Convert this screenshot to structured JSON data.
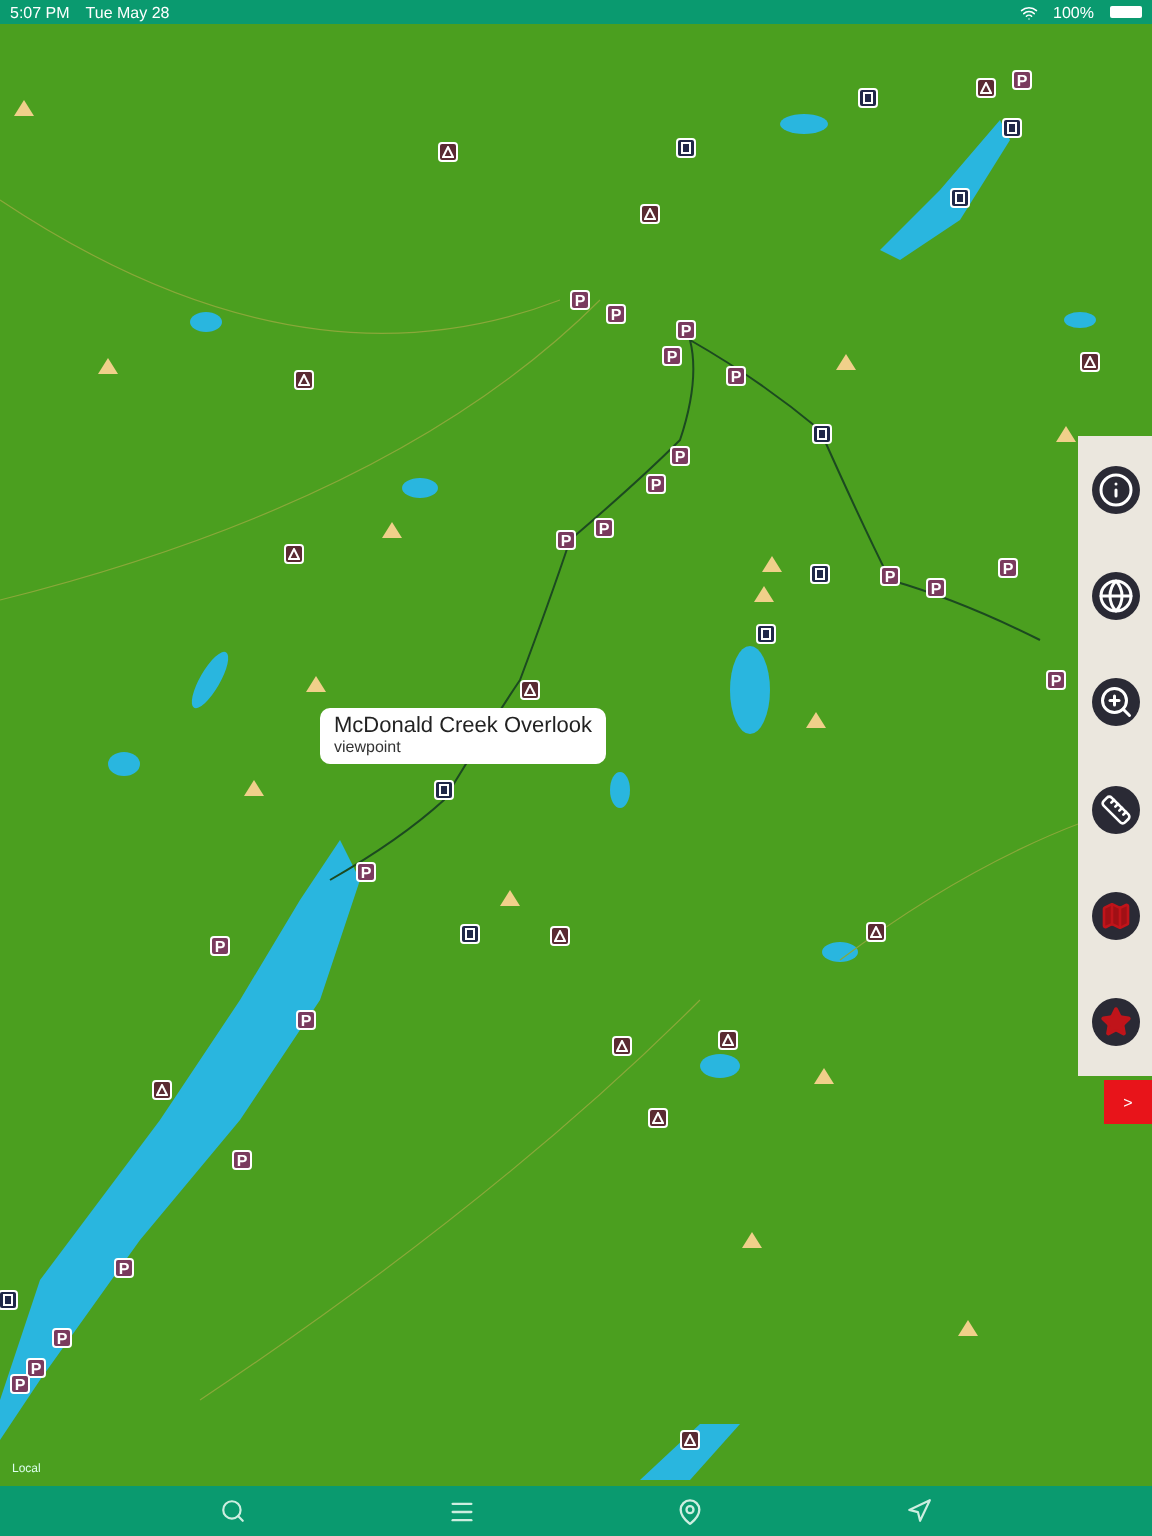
{
  "status_bar": {
    "time": "5:07 PM",
    "date": "Tue May 28",
    "battery": "100%"
  },
  "map": {
    "attribution": "Local",
    "parking_signs": [
      "P",
      "P",
      "P",
      "P",
      "P",
      "P",
      "P",
      "P",
      "P",
      "P",
      "P",
      "P",
      "P",
      "P",
      "P",
      "P",
      "P",
      "P",
      "P",
      "P",
      "P",
      "P"
    ],
    "popup": {
      "title": "McDonald Creek Overlook",
      "subtitle": "viewpoint"
    }
  },
  "side_panel": {
    "collapse_button": ">"
  }
}
